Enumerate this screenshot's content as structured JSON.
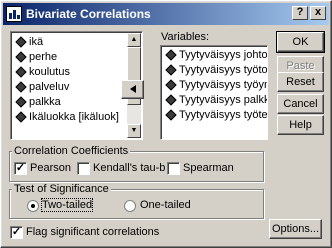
{
  "window": {
    "title": "Bivariate Correlations"
  },
  "title_buttons": {
    "help": "?",
    "close": "x"
  },
  "source_list": {
    "items": [
      "ikä",
      "perhe",
      "koulutus",
      "palveluv",
      "palkka",
      "Ikäluokka [ikäluok]"
    ]
  },
  "move_button": {
    "icon": "left-arrow-icon"
  },
  "variables": {
    "label": "Variables:",
    "items": [
      "Tyytyväisyys johtoon [jo",
      "Tyytyväisyys työtovereil",
      "Tyytyväisyys työympäris",
      "Tyytyväisyys palkkaan",
      "Tyytyväisyys työtehtävii"
    ]
  },
  "buttons": {
    "ok": "OK",
    "paste": "Paste",
    "reset": "Reset",
    "cancel": "Cancel",
    "help": "Help",
    "options": "Options..."
  },
  "coefficients": {
    "label": "Correlation Coefficients",
    "pearson": "Pearson",
    "pearson_checked": true,
    "kendall": "Kendall's tau-b",
    "kendall_checked": false,
    "spearman": "Spearman",
    "spearman_checked": false
  },
  "significance": {
    "label": "Test of Significance",
    "two_tailed": "Two-tailed",
    "one_tailed": "One-tailed",
    "selected": "two-tailed"
  },
  "flag": {
    "label": "Flag significant correlations",
    "checked": true
  }
}
